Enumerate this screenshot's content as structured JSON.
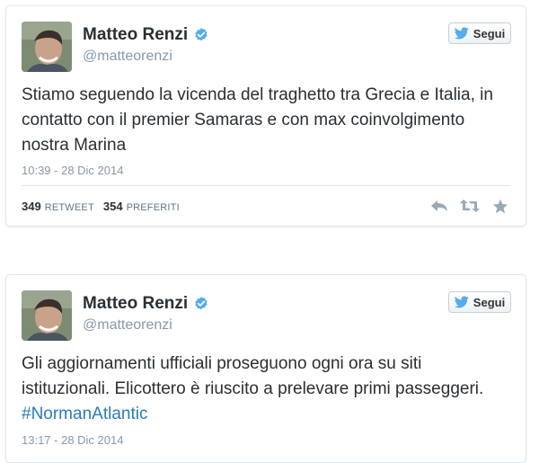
{
  "tweets": [
    {
      "author": {
        "display_name": "Matteo Renzi",
        "username": "@matteorenzi",
        "verified": true
      },
      "follow_label": "Segui",
      "text": "Stiamo seguendo la vicenda del traghetto tra Grecia e Italia, in contatto con il premier Samaras e con max coinvolgimento nostra Marina",
      "timestamp": "10:39 - 28 Dic 2014",
      "stats": {
        "retweets": "349",
        "retweets_label": "RETWEET",
        "favorites": "354",
        "favorites_label": "PREFERITI"
      },
      "actions": [
        "reply-icon",
        "retweet-icon",
        "favorite-icon"
      ]
    },
    {
      "author": {
        "display_name": "Matteo Renzi",
        "username": "@matteorenzi",
        "verified": true
      },
      "follow_label": "Segui",
      "text": "Gli aggiornamenti ufficiali proseguono ogni ora su siti istituzionali. Elicottero è riuscito a prelevare primi passeggeri.",
      "hashtag": "#NormanAtlantic",
      "timestamp": "13:17 - 28 Dic 2014"
    }
  ],
  "colors": {
    "text": "#292f33",
    "muted": "#8899a6",
    "hashtag": "#2b7bb9",
    "verified": "#55acee",
    "twitter_blue": "#55acee",
    "border": "#e1e8ed",
    "action_icon": "#99aab5"
  }
}
